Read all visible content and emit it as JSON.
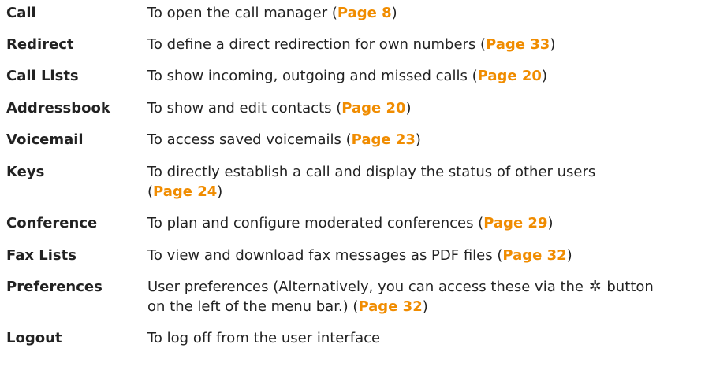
{
  "rows": [
    {
      "term": "Call",
      "text_before": "To open the call manager (",
      "link": "Page 8",
      "text_after": ")"
    },
    {
      "term": "Redirect",
      "text_before": "To define a direct redirection for own numbers (",
      "link": "Page 33",
      "text_after": ")"
    },
    {
      "term": "Call Lists",
      "text_before": "To show incoming, outgoing and missed calls (",
      "link": "Page 20",
      "text_after": ")"
    },
    {
      "term": "Addressbook",
      "text_before": "To show and edit contacts (",
      "link": "Page 20",
      "text_after": ")"
    },
    {
      "term": "Voicemail",
      "text_before": "To access saved voicemails (",
      "link": "Page 23",
      "text_after": ")"
    },
    {
      "term": "Keys",
      "text_line1": "To directly establish a call and display the status of other users",
      "text_before": "(",
      "link": "Page 24",
      "text_after": ")"
    },
    {
      "term": "Conference",
      "text_before": "To plan and configure moderated conferences (",
      "link": "Page 29",
      "text_after": ")"
    },
    {
      "term": "Fax Lists",
      "text_before": "To view and download fax messages as PDF files (",
      "link": "Page 32",
      "text_after": ")"
    },
    {
      "term": "Preferences",
      "text_before": "User preferences (Alternatively, you can access these via the",
      "icon": "gear-icon",
      "text_mid": "button",
      "text_line2": "on the left of the menu bar.) (",
      "link": "Page 32",
      "text_after": ")"
    },
    {
      "term": "Logout",
      "text_before": "To log off from the user interface"
    }
  ],
  "colors": {
    "text": "#222222",
    "link": "#f08c00"
  }
}
